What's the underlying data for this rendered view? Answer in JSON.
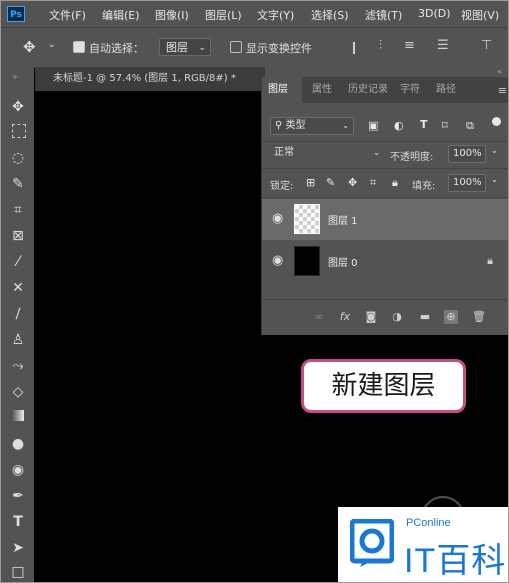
{
  "app": {
    "logo_text": "Ps"
  },
  "menu": {
    "items": [
      "文件(F)",
      "编辑(E)",
      "图像(I)",
      "图层(L)",
      "文字(Y)",
      "选择(S)",
      "滤镜(T)",
      "3D(D)",
      "视图(V)"
    ]
  },
  "options": {
    "auto_select_label": "自动选择：",
    "auto_select_value": "图层",
    "show_transform_label": "显示变换控件"
  },
  "document": {
    "tab_title": "未标题-1 @ 57.4% (图层 1, RGB/8#) *"
  },
  "layers_panel": {
    "tabs": [
      "图层",
      "属性",
      "历史记录",
      "字符",
      "路径"
    ],
    "filter_label": "类型",
    "blend_mode": "正常",
    "opacity_label": "不透明度:",
    "opacity_value": "100%",
    "lock_label": "锁定:",
    "fill_label": "填充:",
    "fill_value": "100%",
    "layers": [
      {
        "name": "图层 1",
        "selected": true,
        "thumbnail": "transparent",
        "locked": false
      },
      {
        "name": "图层 0",
        "selected": false,
        "thumbnail": "black",
        "locked": true
      }
    ],
    "footer_buttons": [
      "link-icon",
      "fx-icon",
      "mask-icon",
      "adjustment-icon",
      "folder-icon",
      "new-layer-icon",
      "trash-icon"
    ],
    "fx_text": "fx"
  },
  "callout": {
    "text": "新建图层",
    "border_color": "#c34d84"
  },
  "watermark": {
    "top_text": "PConline",
    "main_text": "IT百科",
    "color": "#1a77d4"
  }
}
